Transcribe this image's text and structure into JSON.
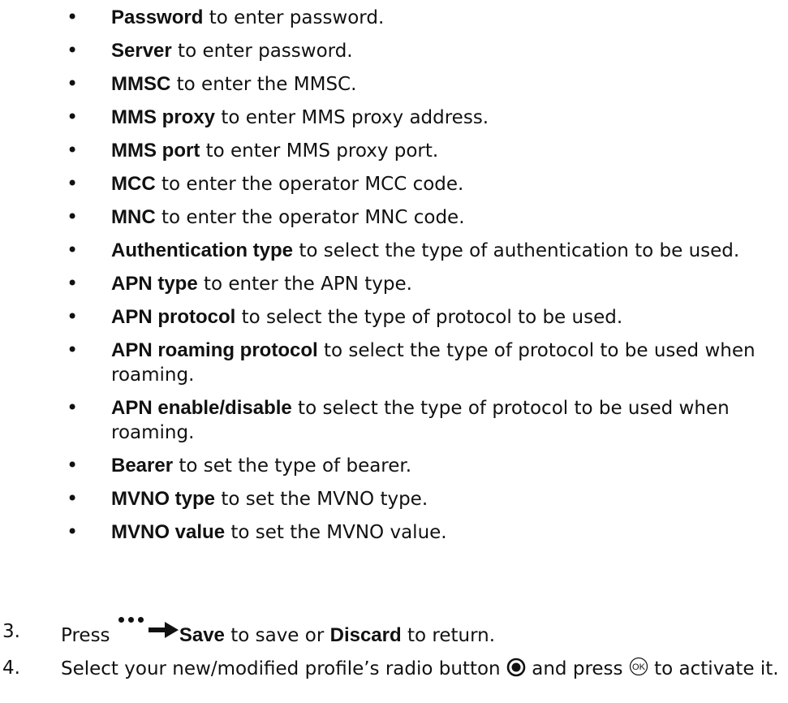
{
  "bullets": [
    {
      "term": "Password",
      "desc": " to enter password."
    },
    {
      "term": "Server",
      "desc": " to enter password."
    },
    {
      "term": "MMSC",
      "desc": " to enter the MMSC."
    },
    {
      "term": "MMS proxy",
      "desc": " to enter MMS proxy address."
    },
    {
      "term": "MMS port",
      "desc": " to enter MMS proxy port."
    },
    {
      "term": "MCC",
      "desc": " to enter the operator MCC code."
    },
    {
      "term": "MNC",
      "desc": " to enter the operator MNC code."
    },
    {
      "term": "Authentication type",
      "desc": " to select the type of authentication to be used."
    },
    {
      "term": "APN type",
      "desc": " to enter the APN type."
    },
    {
      "term": "APN protocol",
      "desc": " to select the type of protocol to be used."
    },
    {
      "term": "APN roaming protocol",
      "desc": " to select the type of protocol to be used when roaming."
    },
    {
      "term": "APN enable/disable",
      "desc": " to select the type of protocol to be used when roaming."
    },
    {
      "term": "Bearer",
      "desc": " to set the type of bearer."
    },
    {
      "term": "MVNO type",
      "desc": " to set the MVNO type."
    },
    {
      "term": "MVNO value",
      "desc": " to set the MVNO value."
    }
  ],
  "bullet_symbol": "•",
  "steps": {
    "step3": {
      "number": "3.",
      "pre": "Press ",
      "icon": "more-options-arrow-icon",
      "save": "Save",
      "mid": " to save or ",
      "discard": "Discard",
      "post": " to return."
    },
    "step4": {
      "number": "4.",
      "pre": "Select your new/modified profile’s radio button ",
      "radio_icon": "radio-selected-icon",
      "mid": " and press ",
      "ok_icon": "ok-key-icon",
      "post": " to activate it."
    }
  }
}
